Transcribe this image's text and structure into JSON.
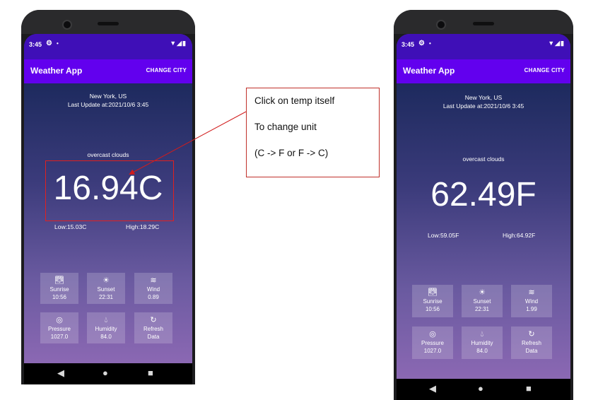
{
  "left_phone": {
    "status": {
      "time": "3:45",
      "gear_icon": "gear-icon",
      "dot": "•",
      "signal": "▼◢▮"
    },
    "app_bar": {
      "title": "Weather App",
      "action": "CHANGE CITY"
    },
    "location": "New York, US",
    "last_update": "Last Update at:2021/10/6 3:45",
    "description": "overcast clouds",
    "temperature": "16.94C",
    "low": "Low:15.03C",
    "high": "High:18.29C",
    "tiles": [
      {
        "icon": "sunrise-icon",
        "label": "Sunrise",
        "value": "10:56"
      },
      {
        "icon": "sunset-icon",
        "label": "Sunset",
        "value": "22:31"
      },
      {
        "icon": "wind-icon",
        "label": "Wind",
        "value": "0.89"
      },
      {
        "icon": "pressure-icon",
        "label": "Pressure",
        "value": "1027.0"
      },
      {
        "icon": "humidity-icon",
        "label": "Humidity",
        "value": "84.0"
      },
      {
        "icon": "refresh-icon",
        "label": "Refresh",
        "value": "Data"
      }
    ]
  },
  "right_phone": {
    "status": {
      "time": "3:45",
      "gear_icon": "gear-icon",
      "dot": "•",
      "signal": "▼◢▮"
    },
    "app_bar": {
      "title": "Weather App",
      "action": "CHANGE CITY"
    },
    "location": "New York, US",
    "last_update": "Last Update at:2021/10/6 3:45",
    "description": "overcast clouds",
    "temperature": "62.49F",
    "low": "Low:59.05F",
    "high": "High:64.92F",
    "tiles": [
      {
        "icon": "sunrise-icon",
        "label": "Sunrise",
        "value": "10:56"
      },
      {
        "icon": "sunset-icon",
        "label": "Sunset",
        "value": "22:31"
      },
      {
        "icon": "wind-icon",
        "label": "Wind",
        "value": "1.99"
      },
      {
        "icon": "pressure-icon",
        "label": "Pressure",
        "value": "1027.0"
      },
      {
        "icon": "humidity-icon",
        "label": "Humidity",
        "value": "84.0"
      },
      {
        "icon": "refresh-icon",
        "label": "Refresh",
        "value": "Data"
      }
    ]
  },
  "nav": {
    "back": "◀",
    "home": "●",
    "recents": "■"
  },
  "callout": {
    "line1": "Click on temp itself",
    "line2": "To change unit",
    "line3": "(C -> F or F -> C)"
  },
  "colors": {
    "accent": "#6200ee",
    "status": "#3f0fb7",
    "highlight": "#e02020"
  }
}
